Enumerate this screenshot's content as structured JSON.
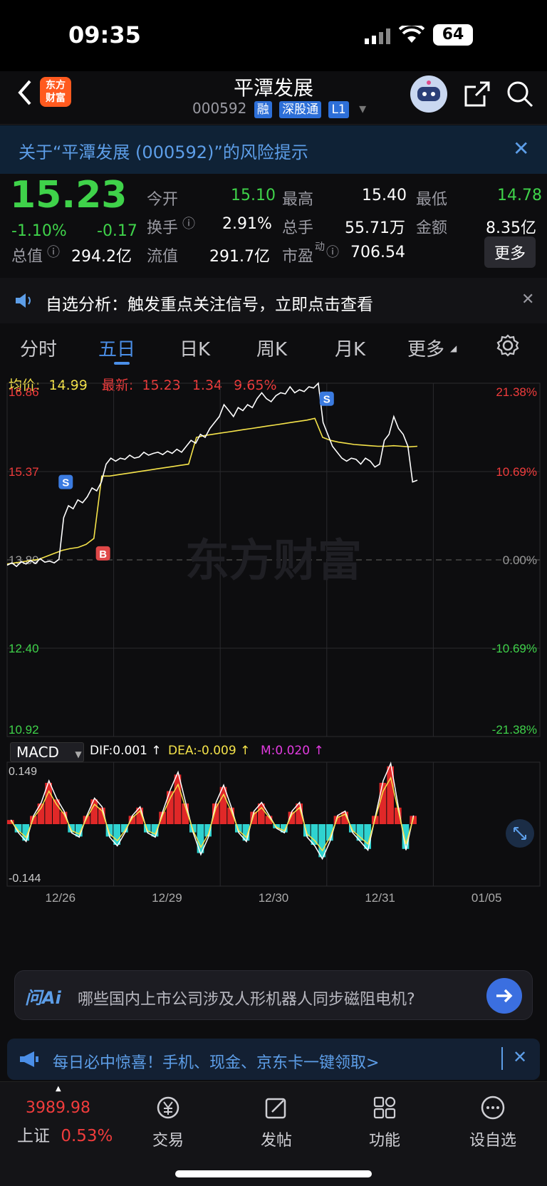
{
  "status": {
    "time": "09:35",
    "battery": "64"
  },
  "nav": {
    "title": "平潭发展",
    "code": "000592",
    "badges": [
      "融",
      "深股通",
      "L1"
    ],
    "logo_line1": "东方",
    "logo_line2": "财富"
  },
  "banner": {
    "text": "关于“平潭发展 (000592)”的风险提示"
  },
  "quote": {
    "price": "15.23",
    "change_pct": "-1.10%",
    "change": "-0.17",
    "open_label": "今开",
    "open": "15.10",
    "high_label": "最高",
    "high": "15.40",
    "low_label": "最低",
    "low": "14.78",
    "turnover_label": "换手",
    "turnover": "2.91%",
    "volume_label": "总手",
    "volume": "55.71万",
    "amount_label": "金额",
    "amount": "8.35亿",
    "mcap_label": "总值",
    "mcap": "294.2亿",
    "float_label": "流值",
    "float": "291.7亿",
    "pe_label": "市盈",
    "pe_sup": "动",
    "pe": "706.54",
    "more": "更多"
  },
  "notice": {
    "text": "自选分析：触发重点关注信号，立即点击查看"
  },
  "tabs": [
    "分时",
    "五日",
    "日K",
    "周K",
    "月K",
    "更多"
  ],
  "chart_info": {
    "avg_label": "均价:",
    "avg": "14.99",
    "latest_label": "最新:",
    "latest": "15.23",
    "change": "1.34",
    "change_pct": "9.65%"
  },
  "chart_data": {
    "type": "line",
    "y_left_ticks": [
      "16.86",
      "15.37",
      "13.89",
      "12.40",
      "10.92"
    ],
    "y_right_ticks": [
      "21.38%",
      "10.69%",
      "0.00%",
      "-10.69%",
      "-21.38%"
    ],
    "x_labels": [
      "12/26",
      "12/29",
      "12/30",
      "12/31",
      "01/05"
    ],
    "ylim": [
      10.92,
      16.86
    ],
    "watermark": "东方财富",
    "markers": [
      {
        "label": "S",
        "day": 0
      },
      {
        "label": "B",
        "day": 0
      },
      {
        "label": "S",
        "day": 3
      }
    ],
    "price": [
      13.8,
      13.84,
      13.78,
      13.86,
      13.82,
      13.88,
      13.83,
      13.91,
      13.85,
      13.87,
      13.84,
      13.9,
      14.6,
      14.8,
      14.75,
      14.9,
      14.85,
      14.95,
      15.1,
      15.05,
      15.2,
      15.5,
      15.6,
      15.55,
      15.6,
      15.58,
      15.65,
      15.6,
      15.62,
      15.7,
      15.65,
      15.68,
      15.7,
      15.66,
      15.72,
      15.68,
      15.75,
      15.7,
      15.8,
      15.9,
      15.85,
      16.0,
      15.95,
      16.1,
      16.2,
      16.3,
      16.5,
      16.4,
      16.3,
      16.45,
      16.4,
      16.5,
      16.45,
      16.6,
      16.7,
      16.6,
      16.55,
      16.65,
      16.7,
      16.68,
      16.8,
      16.7,
      16.75,
      16.72,
      16.8,
      16.78,
      16.86,
      16.2,
      16.0,
      15.8,
      15.7,
      15.6,
      15.55,
      15.6,
      15.58,
      15.5,
      15.6,
      15.55,
      15.45,
      15.5,
      15.9,
      16.0,
      16.3,
      16.1,
      16.0,
      15.8,
      15.2,
      15.23
    ],
    "avg_line": [
      13.82,
      13.84,
      13.86,
      13.88,
      13.9,
      13.95,
      14.0,
      14.05,
      14.08,
      14.1,
      14.15,
      14.25,
      15.3,
      15.3,
      15.32,
      15.34,
      15.36,
      15.38,
      15.4,
      15.42,
      15.44,
      15.46,
      15.48,
      15.5,
      15.95,
      15.98,
      16.0,
      16.02,
      16.04,
      16.06,
      16.08,
      16.1,
      16.12,
      16.14,
      16.16,
      16.18,
      16.2,
      16.22,
      16.24,
      16.27,
      15.95,
      15.9,
      15.87,
      15.85,
      15.83,
      15.82,
      15.81,
      15.8,
      15.8,
      15.81,
      15.8,
      15.79,
      15.8
    ],
    "macd_label": "MACD",
    "dif_label": "DIF:0.001 ↑",
    "dea_label": "DEA:-0.009 ↑",
    "m_label": "M:0.020 ↑",
    "macd_ticks": [
      "0.149",
      "-0.144"
    ],
    "macd_hist": [
      0.01,
      -0.02,
      -0.04,
      0.02,
      0.05,
      0.1,
      0.06,
      0.03,
      -0.02,
      -0.03,
      0.02,
      0.06,
      0.04,
      -0.03,
      -0.05,
      -0.02,
      0.02,
      0.04,
      -0.02,
      -0.03,
      0.03,
      0.08,
      0.12,
      0.05,
      -0.02,
      -0.07,
      -0.03,
      0.05,
      0.09,
      0.04,
      -0.02,
      -0.04,
      0.03,
      0.05,
      0.02,
      -0.01,
      -0.02,
      0.03,
      0.05,
      -0.03,
      -0.05,
      -0.08,
      -0.04,
      0.02,
      0.03,
      -0.02,
      -0.04,
      -0.06,
      0.02,
      0.1,
      0.14,
      0.04,
      -0.06,
      0.02
    ]
  },
  "ask": {
    "text": "哪些国内上市公司涉及人形机器人同步磁阻电机?"
  },
  "promo": {
    "text": "每日必中惊喜！手机、现金、京东卡一键领取>"
  },
  "bottom": {
    "index_value": "3989.98",
    "index_name": "上证",
    "index_change": "0.53%",
    "tabs": [
      "交易",
      "发帖",
      "功能",
      "设自选"
    ]
  }
}
